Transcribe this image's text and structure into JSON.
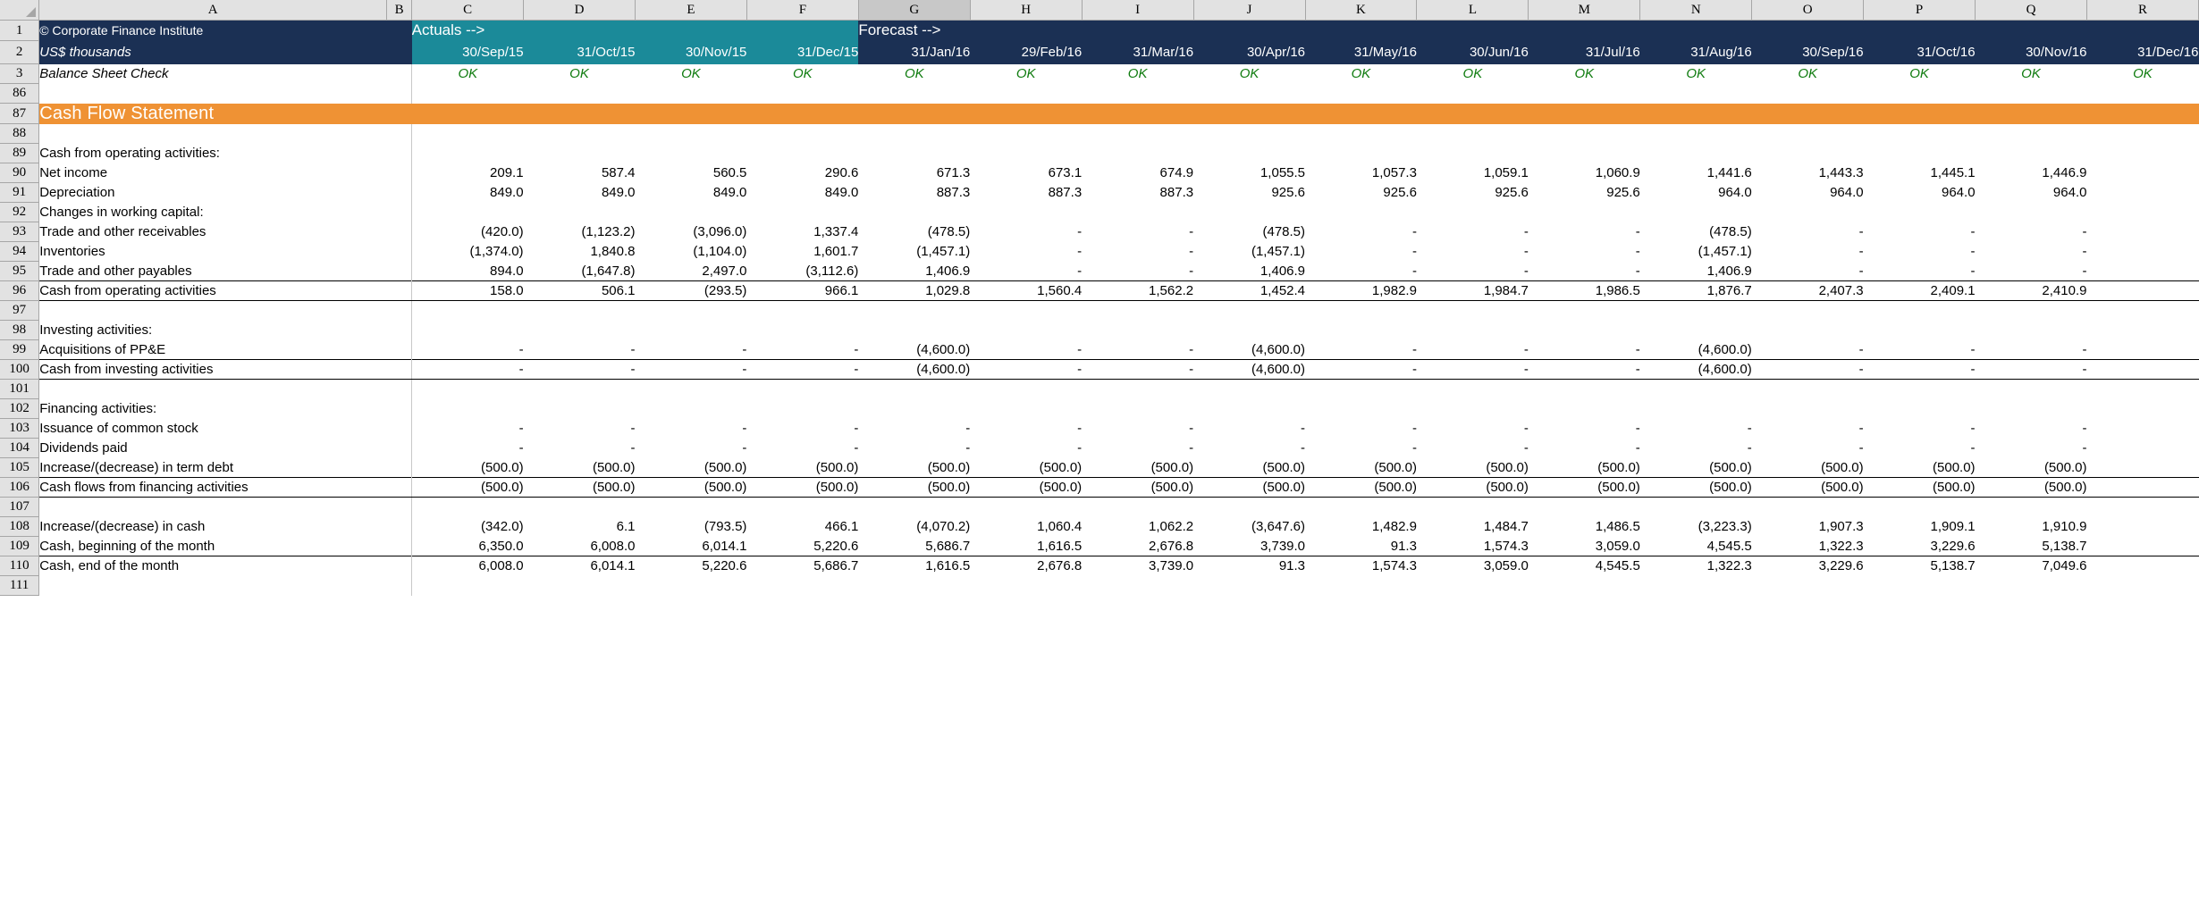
{
  "workbook": {
    "column_letters": [
      "A",
      "B",
      "C",
      "D",
      "E",
      "F",
      "G",
      "H",
      "I",
      "J",
      "K",
      "L",
      "M",
      "N",
      "O",
      "P",
      "Q",
      "R"
    ],
    "selected_column": "G",
    "row_numbers": [
      "1",
      "2",
      "3",
      "86",
      "87",
      "88",
      "89",
      "90",
      "91",
      "92",
      "93",
      "94",
      "95",
      "96",
      "97",
      "98",
      "99",
      "100",
      "101",
      "102",
      "103",
      "104",
      "105",
      "106",
      "107",
      "108",
      "109",
      "110",
      "111"
    ]
  },
  "colors": {
    "navy": "#1b3054",
    "teal": "#1b8a99",
    "orange": "#ef9234",
    "ok_green": "#107c10",
    "header_grey": "#e2e2e2"
  },
  "header": {
    "company": "© Corporate Finance Institute",
    "units": "US$ thousands",
    "actuals_label": "Actuals -->",
    "forecast_label": "Forecast -->",
    "balance_check_label": "Balance Sheet Check",
    "balance_check_value": "OK",
    "dates": [
      "30/Sep/15",
      "31/Oct/15",
      "30/Nov/15",
      "31/Dec/15",
      "31/Jan/16",
      "29/Feb/16",
      "31/Mar/16",
      "30/Apr/16",
      "31/May/16",
      "30/Jun/16",
      "31/Jul/16",
      "31/Aug/16",
      "30/Sep/16",
      "31/Oct/16",
      "30/Nov/16",
      "31/Dec/16"
    ],
    "actuals_count": 4
  },
  "statement": {
    "title": "Cash Flow Statement",
    "sections": {
      "operating_heading": "Cash from operating activities:",
      "working_capital_heading": "Changes in working capital:",
      "investing_heading": "Investing activities:",
      "financing_heading": "Financing activities:"
    }
  },
  "chart_data": {
    "type": "table",
    "title": "Cash Flow Statement",
    "categories": [
      "30/Sep/15",
      "31/Oct/15",
      "30/Nov/15",
      "31/Dec/15",
      "31/Jan/16",
      "29/Feb/16",
      "31/Mar/16",
      "30/Apr/16",
      "31/May/16",
      "30/Jun/16",
      "31/Jul/16",
      "31/Aug/16",
      "30/Sep/16",
      "31/Oct/16",
      "30/Nov/16",
      "31/Dec/16"
    ],
    "series": [
      {
        "name": "Net income",
        "values": [
          "209.1",
          "587.4",
          "560.5",
          "290.6",
          "671.3",
          "673.1",
          "674.9",
          "1,055.5",
          "1,057.3",
          "1,059.1",
          "1,060.9",
          "1,441.6",
          "1,443.3",
          "1,445.1",
          "1,446.9"
        ]
      },
      {
        "name": "Depreciation",
        "values": [
          "849.0",
          "849.0",
          "849.0",
          "849.0",
          "887.3",
          "887.3",
          "887.3",
          "925.6",
          "925.6",
          "925.6",
          "925.6",
          "964.0",
          "964.0",
          "964.0",
          "964.0"
        ]
      },
      {
        "name": "Trade and other receivables",
        "values": [
          "(420.0)",
          "(1,123.2)",
          "(3,096.0)",
          "1,337.4",
          "(478.5)",
          "-",
          "-",
          "(478.5)",
          "-",
          "-",
          "-",
          "(478.5)",
          "-",
          "-",
          "-"
        ]
      },
      {
        "name": "Inventories",
        "values": [
          "(1,374.0)",
          "1,840.8",
          "(1,104.0)",
          "1,601.7",
          "(1,457.1)",
          "-",
          "-",
          "(1,457.1)",
          "-",
          "-",
          "-",
          "(1,457.1)",
          "-",
          "-",
          "-"
        ]
      },
      {
        "name": "Trade and other payables",
        "values": [
          "894.0",
          "(1,647.8)",
          "2,497.0",
          "(3,112.6)",
          "1,406.9",
          "-",
          "-",
          "1,406.9",
          "-",
          "-",
          "-",
          "1,406.9",
          "-",
          "-",
          "-"
        ]
      },
      {
        "name": "Cash from operating activities",
        "values": [
          "158.0",
          "506.1",
          "(293.5)",
          "966.1",
          "1,029.8",
          "1,560.4",
          "1,562.2",
          "1,452.4",
          "1,982.9",
          "1,984.7",
          "1,986.5",
          "1,876.7",
          "2,407.3",
          "2,409.1",
          "2,410.9"
        ]
      },
      {
        "name": "Acquisitions of PP&E",
        "values": [
          "-",
          "-",
          "-",
          "-",
          "(4,600.0)",
          "-",
          "-",
          "(4,600.0)",
          "-",
          "-",
          "-",
          "(4,600.0)",
          "-",
          "-",
          "-"
        ]
      },
      {
        "name": "Cash from investing activities",
        "values": [
          "-",
          "-",
          "-",
          "-",
          "(4,600.0)",
          "-",
          "-",
          "(4,600.0)",
          "-",
          "-",
          "-",
          "(4,600.0)",
          "-",
          "-",
          "-"
        ]
      },
      {
        "name": "Issuance of common stock",
        "values": [
          "-",
          "-",
          "-",
          "-",
          "-",
          "-",
          "-",
          "-",
          "-",
          "-",
          "-",
          "-",
          "-",
          "-",
          "-"
        ]
      },
      {
        "name": "Dividends paid",
        "values": [
          "-",
          "-",
          "-",
          "-",
          "-",
          "-",
          "-",
          "-",
          "-",
          "-",
          "-",
          "-",
          "-",
          "-",
          "-"
        ]
      },
      {
        "name": "Increase/(decrease) in term debt",
        "values": [
          "(500.0)",
          "(500.0)",
          "(500.0)",
          "(500.0)",
          "(500.0)",
          "(500.0)",
          "(500.0)",
          "(500.0)",
          "(500.0)",
          "(500.0)",
          "(500.0)",
          "(500.0)",
          "(500.0)",
          "(500.0)",
          "(500.0)"
        ]
      },
      {
        "name": "Cash flows from financing activities",
        "values": [
          "(500.0)",
          "(500.0)",
          "(500.0)",
          "(500.0)",
          "(500.0)",
          "(500.0)",
          "(500.0)",
          "(500.0)",
          "(500.0)",
          "(500.0)",
          "(500.0)",
          "(500.0)",
          "(500.0)",
          "(500.0)",
          "(500.0)"
        ]
      },
      {
        "name": "Increase/(decrease) in cash",
        "values": [
          "(342.0)",
          "6.1",
          "(793.5)",
          "466.1",
          "(4,070.2)",
          "1,060.4",
          "1,062.2",
          "(3,647.6)",
          "1,482.9",
          "1,484.7",
          "1,486.5",
          "(3,223.3)",
          "1,907.3",
          "1,909.1",
          "1,910.9"
        ]
      },
      {
        "name": "Cash, beginning of the month",
        "values": [
          "6,350.0",
          "6,008.0",
          "6,014.1",
          "5,220.6",
          "5,686.7",
          "1,616.5",
          "2,676.8",
          "3,739.0",
          "91.3",
          "1,574.3",
          "3,059.0",
          "4,545.5",
          "1,322.3",
          "3,229.6",
          "5,138.7"
        ]
      },
      {
        "name": "Cash, end of the month",
        "values": [
          "6,008.0",
          "6,014.1",
          "5,220.6",
          "5,686.7",
          "1,616.5",
          "2,676.8",
          "3,739.0",
          "91.3",
          "1,574.3",
          "3,059.0",
          "4,545.5",
          "1,322.3",
          "3,229.6",
          "5,138.7",
          "7,049.6"
        ]
      }
    ]
  },
  "rows": [
    {
      "row": "86",
      "label": "",
      "style": "blank",
      "values": []
    },
    {
      "row": "87",
      "label": "Cash Flow Statement",
      "style": "banner",
      "values": []
    },
    {
      "row": "88",
      "label": "",
      "style": "blank",
      "values": []
    },
    {
      "row": "89",
      "label": "Cash from operating activities:",
      "style": "heading",
      "values": []
    },
    {
      "row": "90",
      "label": "Net income",
      "style": "normal",
      "values": [
        "209.1",
        "587.4",
        "560.5",
        "290.6",
        "671.3",
        "673.1",
        "674.9",
        "1,055.5",
        "1,057.3",
        "1,059.1",
        "1,060.9",
        "1,441.6",
        "1,443.3",
        "1,445.1",
        "1,446.9"
      ]
    },
    {
      "row": "91",
      "label": "Depreciation",
      "style": "normal",
      "values": [
        "849.0",
        "849.0",
        "849.0",
        "849.0",
        "887.3",
        "887.3",
        "887.3",
        "925.6",
        "925.6",
        "925.6",
        "925.6",
        "964.0",
        "964.0",
        "964.0",
        "964.0"
      ]
    },
    {
      "row": "92",
      "label": "Changes in working capital:",
      "style": "normal",
      "values": []
    },
    {
      "row": "93",
      "label": "Trade and other receivables",
      "style": "indent",
      "values": [
        "(420.0)",
        "(1,123.2)",
        "(3,096.0)",
        "1,337.4",
        "(478.5)",
        "-",
        "-",
        "(478.5)",
        "-",
        "-",
        "-",
        "(478.5)",
        "-",
        "-",
        "-"
      ]
    },
    {
      "row": "94",
      "label": "Inventories",
      "style": "indent",
      "values": [
        "(1,374.0)",
        "1,840.8",
        "(1,104.0)",
        "1,601.7",
        "(1,457.1)",
        "-",
        "-",
        "(1,457.1)",
        "-",
        "-",
        "-",
        "(1,457.1)",
        "-",
        "-",
        "-"
      ]
    },
    {
      "row": "95",
      "label": "Trade and other payables",
      "style": "indent-bottomline",
      "values": [
        "894.0",
        "(1,647.8)",
        "2,497.0",
        "(3,112.6)",
        "1,406.9",
        "-",
        "-",
        "1,406.9",
        "-",
        "-",
        "-",
        "1,406.9",
        "-",
        "-",
        "-"
      ]
    },
    {
      "row": "96",
      "label": "Cash from operating activities",
      "style": "subtotal",
      "values": [
        "158.0",
        "506.1",
        "(293.5)",
        "966.1",
        "1,029.8",
        "1,560.4",
        "1,562.2",
        "1,452.4",
        "1,982.9",
        "1,984.7",
        "1,986.5",
        "1,876.7",
        "2,407.3",
        "2,409.1",
        "2,410.9"
      ]
    },
    {
      "row": "97",
      "label": "",
      "style": "blank",
      "values": []
    },
    {
      "row": "98",
      "label": "Investing activities:",
      "style": "heading",
      "values": []
    },
    {
      "row": "99",
      "label": "Acquisitions of PP&E",
      "style": "indent-bottomline",
      "values": [
        "-",
        "-",
        "-",
        "-",
        "(4,600.0)",
        "-",
        "-",
        "(4,600.0)",
        "-",
        "-",
        "-",
        "(4,600.0)",
        "-",
        "-",
        "-"
      ]
    },
    {
      "row": "100",
      "label": "Cash from investing activities",
      "style": "subtotal",
      "values": [
        "-",
        "-",
        "-",
        "-",
        "(4,600.0)",
        "-",
        "-",
        "(4,600.0)",
        "-",
        "-",
        "-",
        "(4,600.0)",
        "-",
        "-",
        "-"
      ]
    },
    {
      "row": "101",
      "label": "",
      "style": "blank",
      "values": []
    },
    {
      "row": "102",
      "label": "Financing activities:",
      "style": "heading",
      "values": []
    },
    {
      "row": "103",
      "label": "Issuance of common stock",
      "style": "indent",
      "values": [
        "-",
        "-",
        "-",
        "-",
        "-",
        "-",
        "-",
        "-",
        "-",
        "-",
        "-",
        "-",
        "-",
        "-",
        "-"
      ]
    },
    {
      "row": "104",
      "label": "Dividends paid",
      "style": "indent",
      "values": [
        "-",
        "-",
        "-",
        "-",
        "-",
        "-",
        "-",
        "-",
        "-",
        "-",
        "-",
        "-",
        "-",
        "-",
        "-"
      ]
    },
    {
      "row": "105",
      "label": "Increase/(decrease) in term debt",
      "style": "indent-bottomline",
      "values": [
        "(500.0)",
        "(500.0)",
        "(500.0)",
        "(500.0)",
        "(500.0)",
        "(500.0)",
        "(500.0)",
        "(500.0)",
        "(500.0)",
        "(500.0)",
        "(500.0)",
        "(500.0)",
        "(500.0)",
        "(500.0)",
        "(500.0)"
      ]
    },
    {
      "row": "106",
      "label": "Cash flows from financing activities",
      "style": "subtotal",
      "values": [
        "(500.0)",
        "(500.0)",
        "(500.0)",
        "(500.0)",
        "(500.0)",
        "(500.0)",
        "(500.0)",
        "(500.0)",
        "(500.0)",
        "(500.0)",
        "(500.0)",
        "(500.0)",
        "(500.0)",
        "(500.0)",
        "(500.0)"
      ]
    },
    {
      "row": "107",
      "label": "",
      "style": "blank",
      "values": []
    },
    {
      "row": "108",
      "label": "Increase/(decrease) in cash",
      "style": "normal",
      "values": [
        "(342.0)",
        "6.1",
        "(793.5)",
        "466.1",
        "(4,070.2)",
        "1,060.4",
        "1,062.2",
        "(3,647.6)",
        "1,482.9",
        "1,484.7",
        "1,486.5",
        "(3,223.3)",
        "1,907.3",
        "1,909.1",
        "1,910.9"
      ]
    },
    {
      "row": "109",
      "label": "Cash, beginning of the month",
      "style": "bottomline",
      "values": [
        "6,350.0",
        "6,008.0",
        "6,014.1",
        "5,220.6",
        "5,686.7",
        "1,616.5",
        "2,676.8",
        "3,739.0",
        "91.3",
        "1,574.3",
        "3,059.0",
        "4,545.5",
        "1,322.3",
        "3,229.6",
        "5,138.7"
      ]
    },
    {
      "row": "110",
      "label": "Cash, end of the month",
      "style": "total",
      "values": [
        "6,008.0",
        "6,014.1",
        "5,220.6",
        "5,686.7",
        "1,616.5",
        "2,676.8",
        "3,739.0",
        "91.3",
        "1,574.3",
        "3,059.0",
        "4,545.5",
        "1,322.3",
        "3,229.6",
        "5,138.7",
        "7,049.6"
      ]
    },
    {
      "row": "111",
      "label": "",
      "style": "blank",
      "values": []
    }
  ]
}
